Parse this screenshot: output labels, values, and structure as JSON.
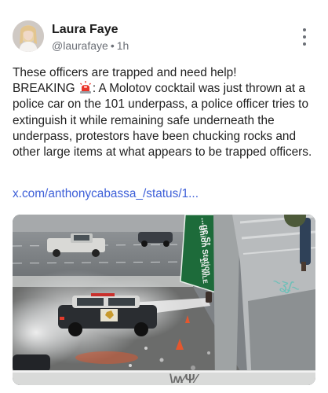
{
  "author": {
    "name": "Laura Faye",
    "handle": "@laurafaye",
    "time": "1h",
    "separator": "•"
  },
  "post": {
    "line1": "These officers are trapped and need help!",
    "line2_prefix": "BREAKING",
    "line2_rest": ": A Molotov cocktail was just thrown at a police car on the 101 underpass, a police officer tries to extinguish it while remaining safe underneath the underpass, protestors have been chucking rocks and other large items at what appears to be trapped officers.",
    "link": "x.com/anthonycabassa_/status/1..."
  },
  "media": {
    "sign_lines": [
      "...ge St",
      "Union Station",
      "1/4 MILE"
    ]
  },
  "icons": {
    "alert": "police-light-icon",
    "more": "more-vertical-icon"
  },
  "colors": {
    "link": "#3d5fd8",
    "meta": "#6b6f76",
    "sign": "#1d6b3a"
  }
}
